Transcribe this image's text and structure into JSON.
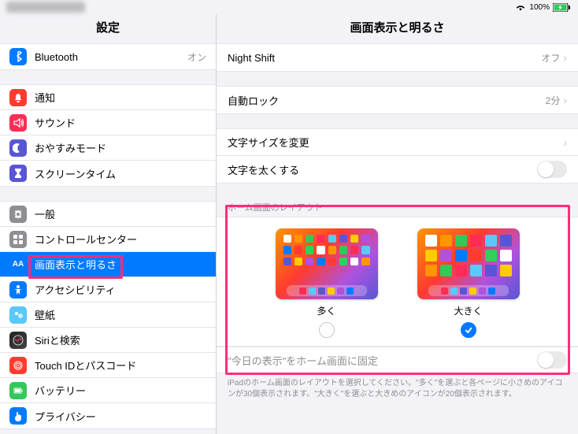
{
  "status": {
    "battery": "100%"
  },
  "sidebar": {
    "title": "設定",
    "g1": [
      {
        "label": "Bluetooth",
        "value": "オン",
        "ico": "#007aff",
        "svg": "bt"
      }
    ],
    "g2": [
      {
        "label": "通知",
        "ico": "#ff3b30",
        "svg": "bell"
      },
      {
        "label": "サウンド",
        "ico": "#ff2d55",
        "svg": "sound"
      },
      {
        "label": "おやすみモード",
        "ico": "#5856d6",
        "svg": "moon"
      },
      {
        "label": "スクリーンタイム",
        "ico": "#5856d6",
        "svg": "hour"
      }
    ],
    "g3": [
      {
        "label": "一般",
        "ico": "#8e8e93",
        "svg": "gear"
      },
      {
        "label": "コントロールセンター",
        "ico": "#8e8e93",
        "svg": "ctrl"
      },
      {
        "label": "画面表示と明るさ",
        "ico": "#007aff",
        "svg": "AA",
        "selected": true
      },
      {
        "label": "アクセシビリティ",
        "ico": "#007aff",
        "svg": "acc"
      },
      {
        "label": "壁紙",
        "ico": "#5ac8fa",
        "svg": "wall"
      },
      {
        "label": "Siriと検索",
        "ico": "#222",
        "svg": "siri"
      },
      {
        "label": "Touch IDとパスコード",
        "ico": "#ff3b30",
        "svg": "touch"
      },
      {
        "label": "バッテリー",
        "ico": "#34c759",
        "svg": "batt"
      },
      {
        "label": "プライバシー",
        "ico": "#007aff",
        "svg": "hand"
      }
    ]
  },
  "detail": {
    "title": "画面表示と明るさ",
    "nightshift": {
      "label": "Night Shift",
      "value": "オフ"
    },
    "autolock": {
      "label": "自動ロック",
      "value": "2分"
    },
    "textsize": {
      "label": "文字サイズを変更"
    },
    "bold": {
      "label": "文字を太くする"
    },
    "layout": {
      "header": "ホーム画面のレイアウト",
      "more": "多く",
      "big": "大きく",
      "selected": "big"
    },
    "fix": {
      "label": "\"今日の表示\"をホーム画面に固定"
    },
    "footer": "iPadのホーム画面のレイアウトを選択してください。\"多く\"を選ぶと各ページに小さめのアイコンが30個表示されます。\"大きく\"を選ぶと大きめのアイコンが20個表示されます。"
  },
  "colors": [
    "#fff",
    "#ff9500",
    "#34c759",
    "#ff2d55",
    "#5ac8fa",
    "#5856d6",
    "#ffcc00",
    "#af52de",
    "#007aff",
    "#ff3b30",
    "#30d158"
  ]
}
